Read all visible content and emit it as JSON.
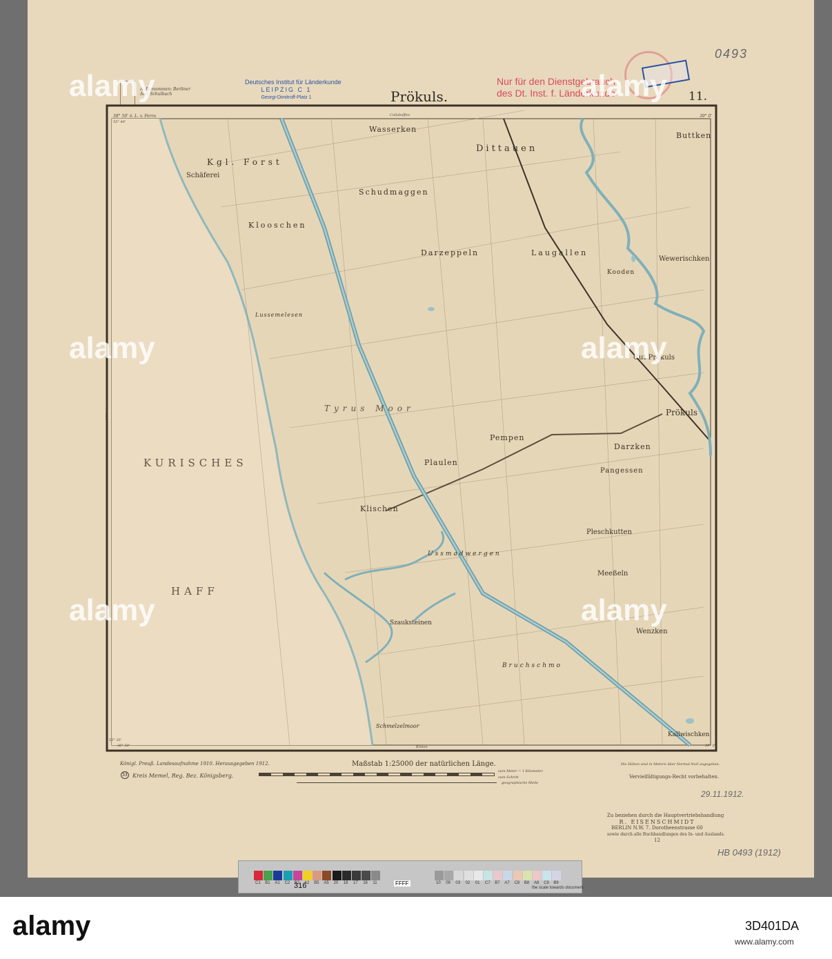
{
  "sheet": {
    "title": "Prökuls.",
    "sheet_number": "11.",
    "top_left_note": "Aufgenommen: Berliner Amt Schulbuch",
    "corner_coord_top_left": "38° 50' ö. L. v. Ferro",
    "corner_coord_top_right": "39° 0'",
    "corner_coord_bottom_left": "38° 50'",
    "corner_coord_bottom_right": "39° 0'",
    "lat_top": "55° 40'",
    "lat_bottom": "55° 35'",
    "top_edge_label": "Collaboffen",
    "bottom_edge_label": "Kinten",
    "left_edge_label": "Wilhelmsort"
  },
  "stamps": {
    "institute_line1": "Deutsches Institut für Länderkunde",
    "institute_line2": "LEIPZIG C 1",
    "institute_line3": "Georgi-Dimitroff-Platz 1",
    "restricted_line1": "Nur für den Dienstgebrauch",
    "restricted_line2": "des Dt. Inst. f. Länderkunde"
  },
  "handwritten": {
    "catalog_top": "0493",
    "date": "29.11.1912.",
    "catalog_bottom": "HB 0493 (1912)",
    "card_number": "316"
  },
  "places": [
    {
      "name": "Wasserken"
    },
    {
      "name": "Dittauen"
    },
    {
      "name": "Buttken"
    },
    {
      "name": "Kgl. Forst"
    },
    {
      "name": "Schäferei"
    },
    {
      "name": "Schudmaggen"
    },
    {
      "name": "Klooschen"
    },
    {
      "name": "Darzeppeln"
    },
    {
      "name": "Laugallen"
    },
    {
      "name": "Kooden"
    },
    {
      "name": "Wewerischken"
    },
    {
      "name": "Gut Prökuls"
    },
    {
      "name": "Prökuls"
    },
    {
      "name": "Tyrus Moor"
    },
    {
      "name": "Pempen"
    },
    {
      "name": "Darzken"
    },
    {
      "name": "Pangessen"
    },
    {
      "name": "Plaulen"
    },
    {
      "name": "Klischen"
    },
    {
      "name": "Pleschkutten"
    },
    {
      "name": "Ussmadwergen"
    },
    {
      "name": "Meeßeln"
    },
    {
      "name": "Szauksteinen"
    },
    {
      "name": "Wenzken"
    },
    {
      "name": "Bruchschmo"
    },
    {
      "name": "Kallwischken"
    },
    {
      "name": "Lussemelesen"
    },
    {
      "name": "Schmelzelmoor"
    }
  ],
  "water": {
    "lagoon_word1": "KURISCHES",
    "lagoon_word2": "HAFF"
  },
  "margin": {
    "edition_note": "Königl. Preuß. Landesaufnahme 1910. Herausgegeben 1912.",
    "district": "Kreis Memel, Reg. Bez. Königsberg.",
    "district_number": "33",
    "scale_title": "Maßstab 1:25000 der natürlichen Länge.",
    "scale_unit_meters": "zum Meter = 1 Kilometer",
    "scale_unit_steps": "zum Schritt",
    "scale_unit_miles": "geographische Meile",
    "heights_note": "Die Höhen sind in Metern über Normal-Null angegeben.",
    "rights": "Vervielfältigungs-Recht vorbehalten.",
    "publisher_line1": "Zu beziehen durch die Hauptvertriebshandlung",
    "publisher_name": "R. EISENSCHMIDT",
    "publisher_address": "BERLIN N.W. 7. Dorotheenstrasse 60",
    "publisher_line4": "sowie durch alle Buchhandlungen des In- und Auslands.",
    "print_number": "12"
  },
  "color_card": {
    "patches": [
      {
        "label": "C1",
        "color": "#d8283c"
      },
      {
        "label": "B1",
        "color": "#4aa24a"
      },
      {
        "label": "A1",
        "color": "#1c3a9a"
      },
      {
        "label": "C2",
        "color": "#1aa0b0"
      },
      {
        "label": "B2",
        "color": "#c8449a"
      },
      {
        "label": "A2",
        "color": "#f0d020"
      },
      {
        "label": "B5",
        "color": "#d89a80"
      },
      {
        "label": "A5",
        "color": "#8a4a26"
      },
      {
        "label": "20",
        "color": "#1a1a1a"
      },
      {
        "label": "18",
        "color": "#2a2a2a"
      },
      {
        "label": "17",
        "color": "#3a3a3a"
      },
      {
        "label": "16",
        "color": "#4a4a4a"
      },
      {
        "label": "11",
        "color": "#8a8a8a"
      },
      {
        "label": "10",
        "color": "#9a9a9a"
      },
      {
        "label": "09",
        "color": "#a8a8a8"
      },
      {
        "label": "03",
        "color": "#d8d8d8"
      },
      {
        "label": "02",
        "color": "#e0e0e0"
      },
      {
        "label": "01",
        "color": "#e8e8e8"
      },
      {
        "label": "C7",
        "color": "#c8e4e4"
      },
      {
        "label": "B7",
        "color": "#e8c8cc"
      },
      {
        "label": "A7",
        "color": "#c8d8e8"
      },
      {
        "label": "C8",
        "color": "#ecc8b4"
      },
      {
        "label": "B8",
        "color": "#d8e4b0"
      },
      {
        "label": "A8",
        "color": "#ecc8c8"
      },
      {
        "label": "C9",
        "color": "#c8e4ec"
      },
      {
        "label": "B9",
        "color": "#d4d4e4"
      }
    ],
    "footer_note": "the scale towards document",
    "focus_text": "FFFF"
  },
  "watermark": {
    "brand": "alamy",
    "image_id": "3D401DA",
    "url": "www.alamy.com"
  },
  "colors": {
    "paper": "#e8d9bd",
    "water": "#ecdcc2",
    "canal": "#7fb0b8",
    "ink": "#4a4236"
  }
}
